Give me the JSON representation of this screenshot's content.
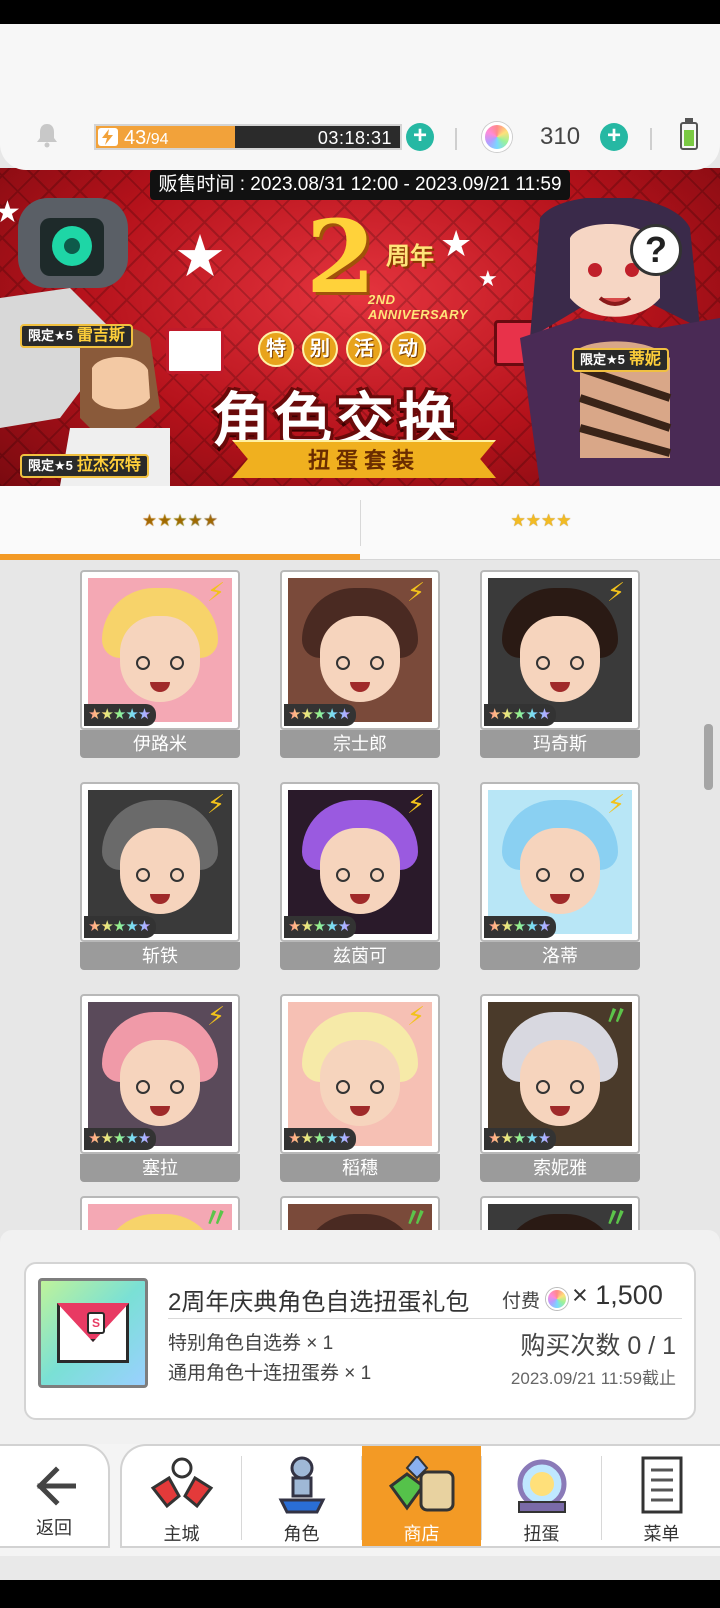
{
  "header": {
    "stamina_current": "43",
    "stamina_max": "/94",
    "stamina_fraction": 0.457,
    "timer": "03:18:31",
    "gem_count": "310"
  },
  "banner": {
    "sale_period": "贩售时间 : 2023.08/31 12:00 - 2023.09/21 11:59",
    "anniversary_number": "2",
    "anniversary_word": "周年",
    "anniversary_en": "2ND ANNIVERSARY",
    "event_tag": [
      "特",
      "别",
      "活",
      "动"
    ],
    "title": "角色交换",
    "subtitle": "扭蛋套装",
    "tags": [
      {
        "prefix": "限定★5",
        "name": "雷吉斯"
      },
      {
        "prefix": "限定★5",
        "name": "拉杰尔特"
      },
      {
        "prefix": "限定★5",
        "name": "蒂妮"
      }
    ],
    "help": "?"
  },
  "tabs": [
    {
      "label": "★★★★★",
      "active": true
    },
    {
      "label": "★★★★",
      "active": false
    }
  ],
  "characters": [
    {
      "name": "伊路米",
      "rarity": "★★★★★",
      "element": "lightning"
    },
    {
      "name": "宗士郎",
      "rarity": "★★★★★",
      "element": "lightning"
    },
    {
      "name": "玛奇斯",
      "rarity": "★★★★★",
      "element": "lightning"
    },
    {
      "name": "斩铁",
      "rarity": "★★★★★",
      "element": "lightning"
    },
    {
      "name": "兹茵可",
      "rarity": "★★★★★",
      "element": "lightning"
    },
    {
      "name": "洛蒂",
      "rarity": "★★★★★",
      "element": "lightning"
    },
    {
      "name": "塞拉",
      "rarity": "★★★★★",
      "element": "lightning"
    },
    {
      "name": "稻穗",
      "rarity": "★★★★★",
      "element": "lightning"
    },
    {
      "name": "索妮雅",
      "rarity": "★★★★★",
      "element": "wind"
    }
  ],
  "product": {
    "title": "2周年庆典角色自选扭蛋礼包",
    "pay_label": "付费",
    "price": "× 1,500",
    "items": [
      "特别角色自选券 × 1",
      "通用角色十连扭蛋券 × 1"
    ],
    "purchase_count": "购买次数 0 / 1",
    "deadline": "2023.09/21 11:59截止"
  },
  "nav": {
    "back": "返回",
    "items": [
      {
        "label": "主城",
        "active": false
      },
      {
        "label": "角色",
        "active": false
      },
      {
        "label": "商店",
        "active": true
      },
      {
        "label": "扭蛋",
        "active": false
      },
      {
        "label": "菜单",
        "active": false
      }
    ]
  },
  "colors": {
    "accent": "#f39a25",
    "teal": "#26b8a3",
    "banner_red": "#c8141f",
    "lightning": "#f2c21b",
    "wind": "#5cc44a"
  }
}
